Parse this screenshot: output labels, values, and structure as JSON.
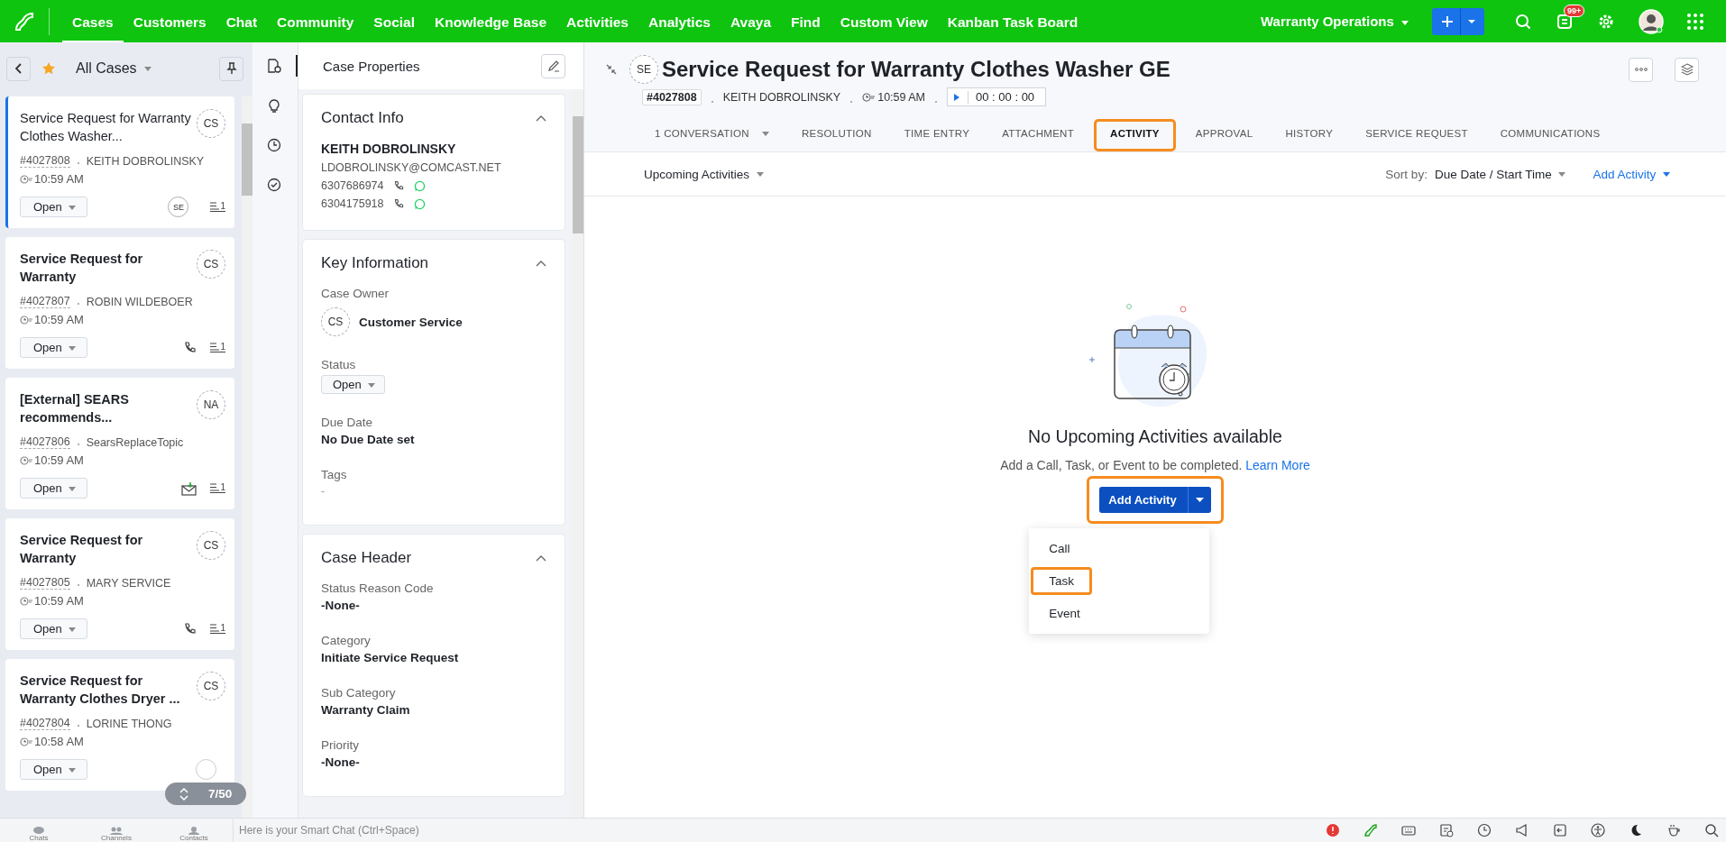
{
  "top_nav": {
    "items": [
      {
        "label": "Cases",
        "selected": true
      },
      {
        "label": "Customers",
        "selected": false
      },
      {
        "label": "Chat",
        "selected": false
      },
      {
        "label": "Community",
        "selected": false
      },
      {
        "label": "Social",
        "selected": false
      },
      {
        "label": "Knowledge Base",
        "selected": false
      },
      {
        "label": "Activities",
        "selected": false
      },
      {
        "label": "Analytics",
        "selected": false
      },
      {
        "label": "Avaya",
        "selected": false
      },
      {
        "label": "Find",
        "selected": false
      },
      {
        "label": "Custom View",
        "selected": false
      },
      {
        "label": "Kanban Task Board",
        "selected": false
      }
    ],
    "workspace": "Warranty Operations",
    "notification_badge": "99+"
  },
  "case_list": {
    "title": "All Cases",
    "counter": "7/50",
    "cases": [
      {
        "title": "Service Request for Warranty Clothes Washer...",
        "id": "#4027808",
        "contact": "KEITH DOBROLINSKY",
        "time": "10:59 AM",
        "owner": "CS",
        "status": "Open",
        "selected": true,
        "unread": false,
        "channel": {
          "kind": "agent",
          "label": "SE"
        },
        "thread_count": "1"
      },
      {
        "title": "Service Request for Warranty",
        "id": "#4027807",
        "contact": "ROBIN WILDEBOER",
        "time": "10:59 AM",
        "owner": "CS",
        "status": "Open",
        "selected": false,
        "unread": true,
        "channel": {
          "kind": "phone"
        },
        "thread_count": "1"
      },
      {
        "title": "[External] SEARS recommends...",
        "id": "#4027806",
        "contact": "SearsReplaceTopic",
        "time": "10:59 AM",
        "owner": "NA",
        "status": "Open",
        "selected": false,
        "unread": true,
        "channel": {
          "kind": "email"
        },
        "thread_count": "1"
      },
      {
        "title": "Service Request for Warranty",
        "id": "#4027805",
        "contact": "MARY SERVICE",
        "time": "10:59 AM",
        "owner": "CS",
        "status": "Open",
        "selected": false,
        "unread": true,
        "channel": {
          "kind": "phone"
        },
        "thread_count": "1"
      },
      {
        "title": "Service Request for Warranty Clothes Dryer ...",
        "id": "#4027804",
        "contact": "LORINE THONG",
        "time": "10:58 AM",
        "owner": "CS",
        "status": "Open",
        "selected": false,
        "unread": true,
        "channel": {
          "kind": "covered"
        }
      }
    ]
  },
  "rail": [
    {
      "kind": "properties",
      "selected": true
    },
    {
      "kind": "ideas",
      "selected": false
    },
    {
      "kind": "history",
      "selected": false
    },
    {
      "kind": "checklist",
      "selected": false
    }
  ],
  "properties": {
    "title": "Case Properties",
    "sections": [
      {
        "kind": "contact",
        "title": "Contact Info",
        "expanded": true,
        "name": "KEITH DOBROLINSKY",
        "email": "LDOBROLINSKY@COMCAST.NET",
        "phones": [
          "6307686974",
          "6304175918"
        ]
      },
      {
        "kind": "fields",
        "title": "Key Information",
        "expanded": true,
        "fields": [
          {
            "kind": "owner",
            "label": "Case Owner",
            "initials": "CS",
            "value": "Customer Service"
          },
          {
            "kind": "status",
            "label": "Status",
            "value": "Open"
          },
          {
            "kind": "text",
            "label": "Due Date",
            "value": "No Due Date set"
          },
          {
            "kind": "empty",
            "label": "Tags",
            "value": "-"
          }
        ]
      },
      {
        "kind": "fields",
        "title": "Case Header",
        "expanded": true,
        "fields": [
          {
            "kind": "text",
            "label": "Status Reason Code",
            "value": "-None-"
          },
          {
            "kind": "text",
            "label": "Category",
            "value": "Initiate Service Request"
          },
          {
            "kind": "text",
            "label": "Sub Category",
            "value": "Warranty Claim"
          },
          {
            "kind": "text",
            "label": "Priority",
            "value": "-None-"
          }
        ]
      }
    ]
  },
  "case": {
    "initials": "SE",
    "title": "Service Request for Warranty Clothes Washer GE",
    "id": "#4027808",
    "contact": "KEITH DOBROLINSKY",
    "time": "10:59 AM",
    "timer": "00 : 00 : 00"
  },
  "tabs": [
    {
      "label": "1 CONVERSATION",
      "selected": false,
      "dropdown": true,
      "highlighted": false
    },
    {
      "label": "RESOLUTION",
      "selected": false,
      "dropdown": false,
      "highlighted": false
    },
    {
      "label": "TIME ENTRY",
      "selected": false,
      "dropdown": false,
      "highlighted": false
    },
    {
      "label": "ATTACHMENT",
      "selected": false,
      "dropdown": false,
      "highlighted": false
    },
    {
      "label": "ACTIVITY",
      "selected": true,
      "dropdown": false,
      "highlighted": true
    },
    {
      "label": "APPROVAL",
      "selected": false,
      "dropdown": false,
      "highlighted": false
    },
    {
      "label": "HISTORY",
      "selected": false,
      "dropdown": false,
      "highlighted": false
    },
    {
      "label": "SERVICE REQUEST",
      "selected": false,
      "dropdown": false,
      "highlighted": false
    },
    {
      "label": "COMMUNICATIONS",
      "selected": false,
      "dropdown": false,
      "highlighted": false
    }
  ],
  "activity": {
    "filter": "Upcoming Activities",
    "sort_label": "Sort by:",
    "sort_value": "Due Date / Start Time",
    "add_link": "Add Activity",
    "empty_title": "No Upcoming Activities available",
    "empty_text": "Add a Call, Task, or Event to be completed.",
    "learn_more": "Learn More",
    "add_button": "Add Activity",
    "add_button_highlighted": true,
    "menu": [
      {
        "label": "Call",
        "highlighted": false
      },
      {
        "label": "Task",
        "highlighted": true
      },
      {
        "label": "Event",
        "highlighted": false
      }
    ]
  },
  "bottom_bar": {
    "shortcuts": [
      "Chats",
      "Channels",
      "Contacts"
    ],
    "chat_placeholder": "Here is your Smart Chat (Ctrl+Space)"
  }
}
